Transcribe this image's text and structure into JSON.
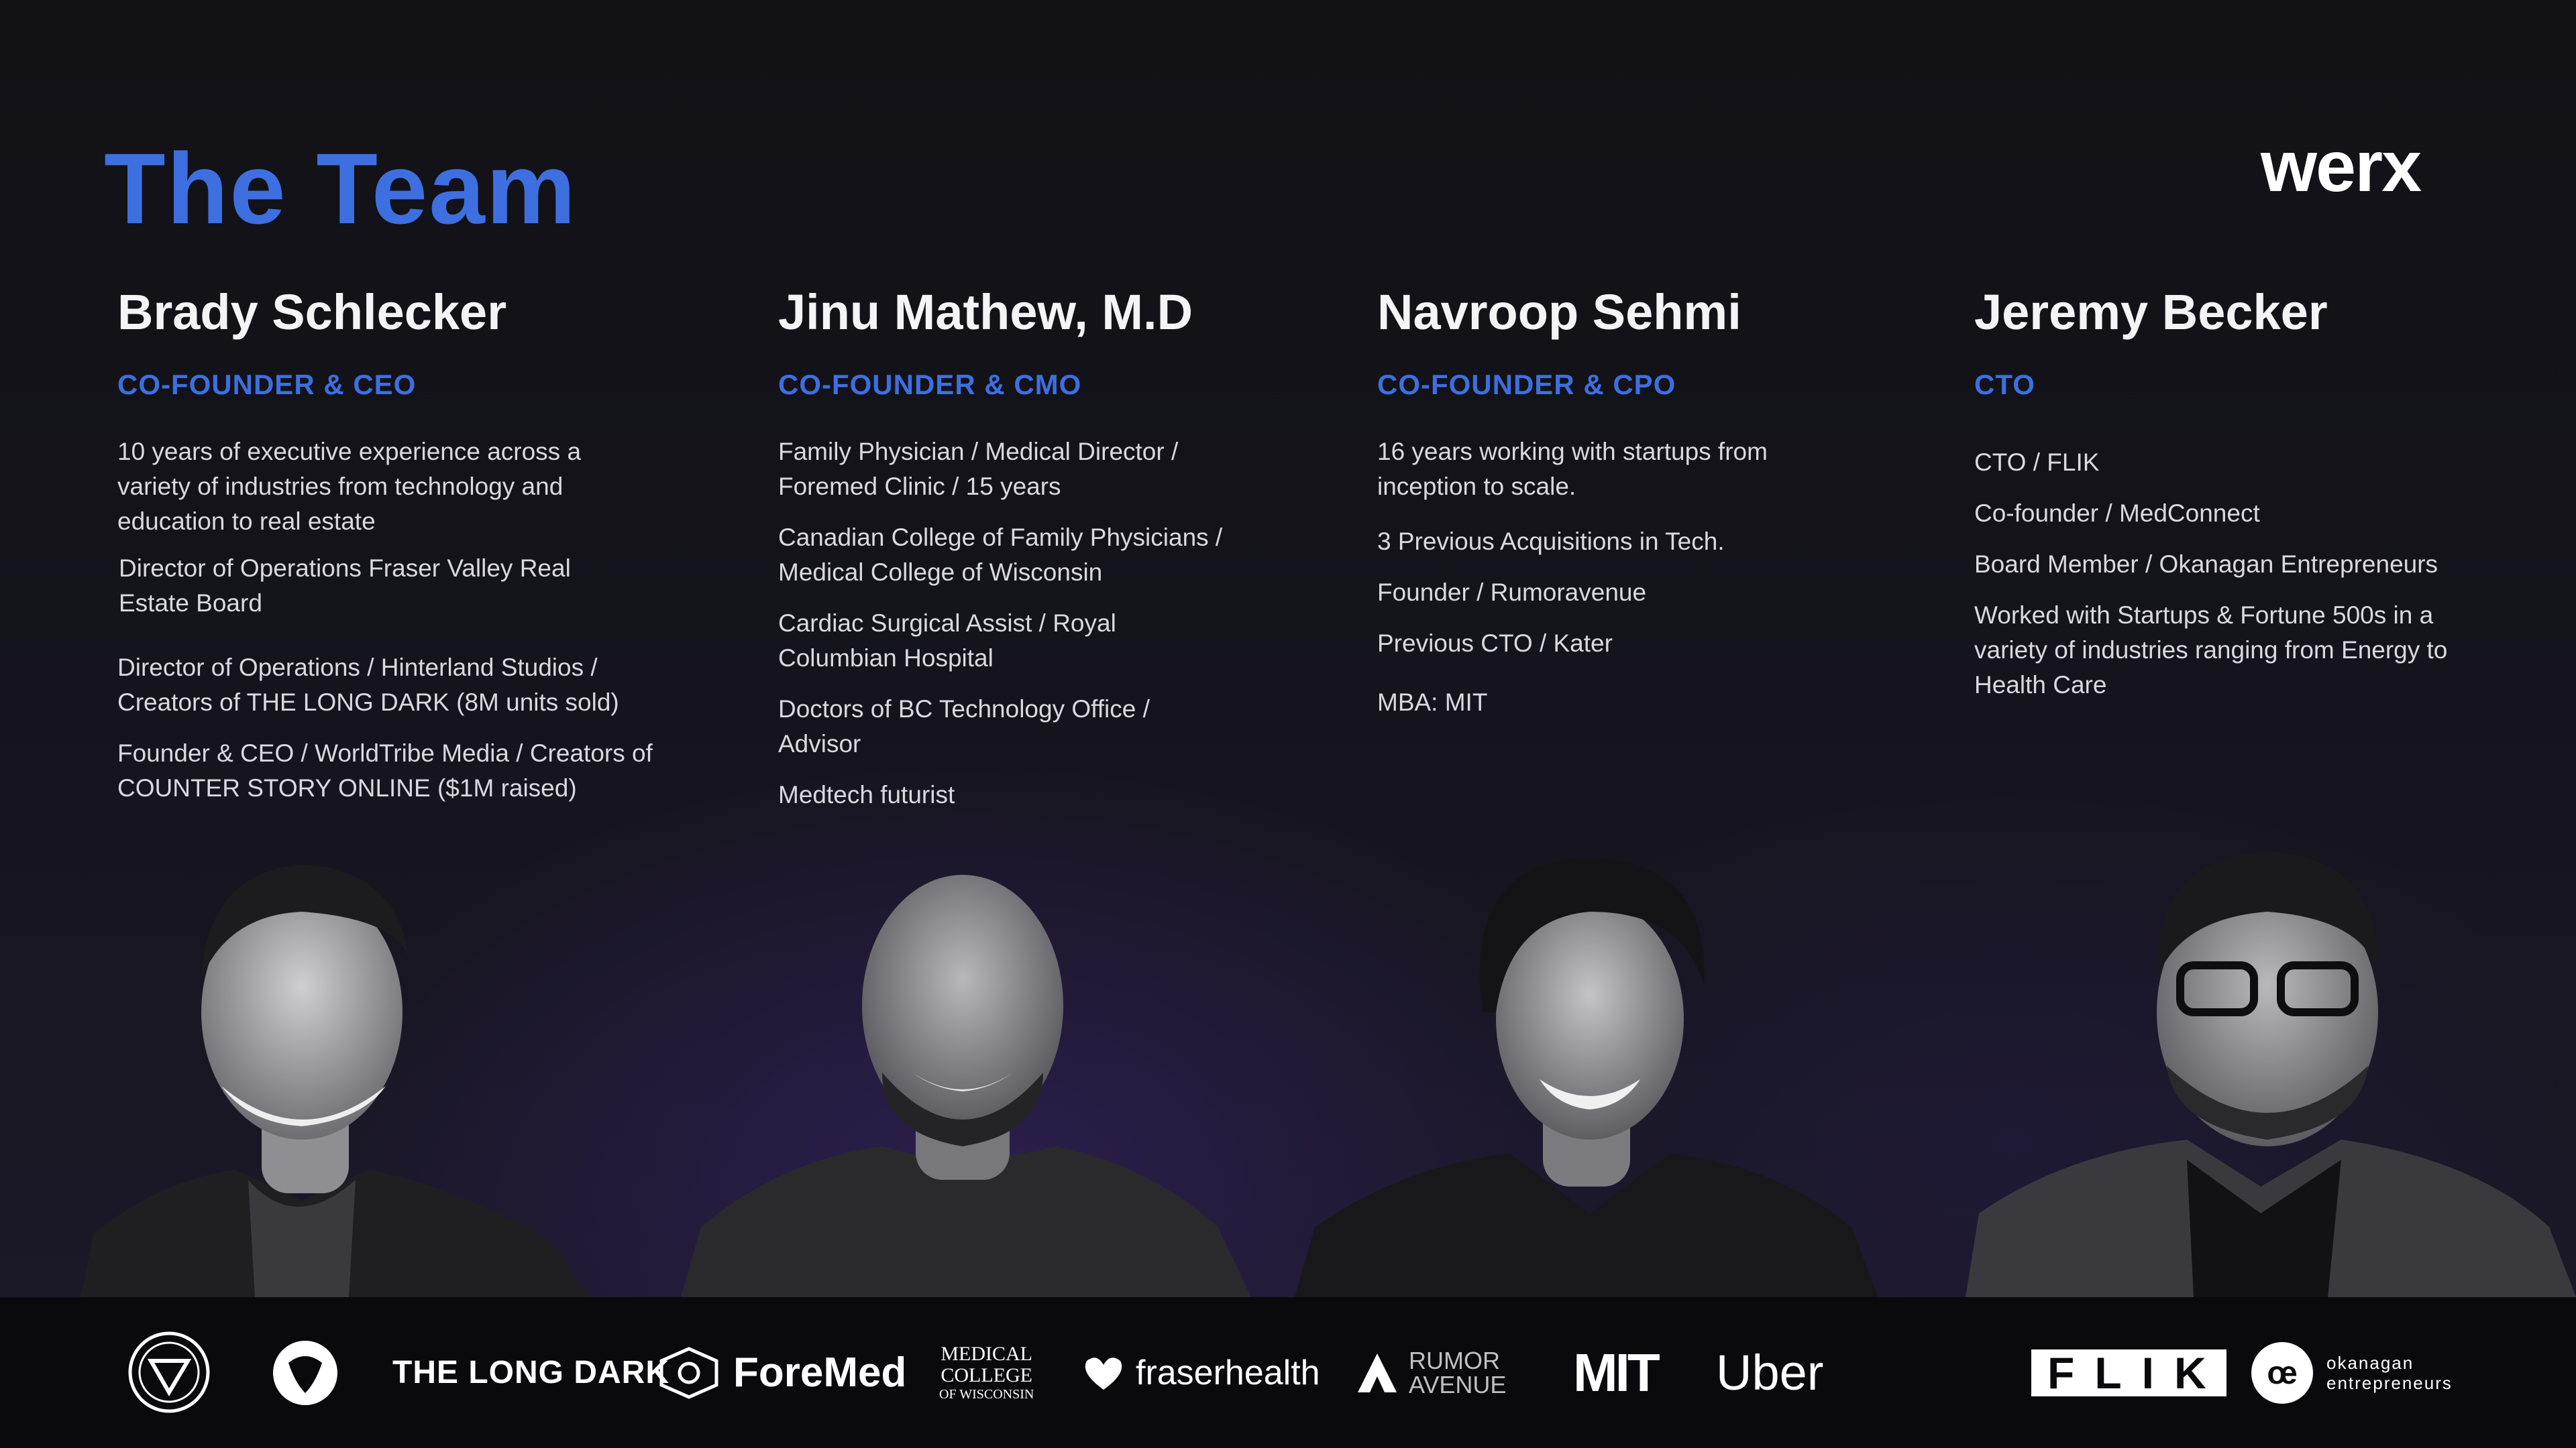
{
  "slide": {
    "title": "The Team",
    "brand_logo": "werx"
  },
  "team": [
    {
      "name": "Brady Schlecker",
      "role": "CO-FOUNDER & CEO",
      "items": [
        "10 years of executive experience across a variety of industries from technology and education to real estate",
        "Director of Operations Fraser Valley Real Estate Board",
        "Director of Operations / Hinterland Studios / Creators of THE LONG DARK (8M units sold)",
        "Founder & CEO / WorldTribe Media / Creators of COUNTER STORY ONLINE ($1M raised)"
      ]
    },
    {
      "name": "Jinu Mathew, M.D",
      "role": "CO-FOUNDER & CMO",
      "items": [
        "Family Physician / Medical Director / Foremed Clinic / 15 years",
        "Canadian College of Family Physicians / Medical College of Wisconsin",
        "Cardiac Surgical Assist / Royal Columbian Hospital",
        "Doctors of BC Technology Office / Advisor",
        "Medtech futurist"
      ]
    },
    {
      "name": "Navroop Sehmi",
      "role": "CO-FOUNDER & CPO",
      "items": [
        "16 years working with startups from inception to scale.",
        "3 Previous Acquisitions in Tech.",
        "Founder / Rumoravenue",
        "Previous CTO / Kater",
        "MBA: MIT"
      ]
    },
    {
      "name": "Jeremy Becker",
      "role": "CTO",
      "items": [
        "CTO / FLIK",
        "Co-founder / MedConnect",
        "Board Member / Okanagan Entrepreneurs",
        "Worked with Startups & Fortune 500s in a variety of industries ranging from Energy to Health Care"
      ]
    }
  ],
  "logos": {
    "long_dark": "THE LONG DARK",
    "foremed": "ForeMed",
    "mcw_line1": "MEDICAL",
    "mcw_line2": "COLLEGE",
    "mcw_line3": "OF WISCONSIN",
    "fraserhealth": "fraserhealth",
    "rumor_line1": "RUMOR",
    "rumor_line2": "AVENUE",
    "mit": "MIT",
    "uber": "Uber",
    "flik": "FLIK",
    "okanagan_line1": "okanagan",
    "okanagan_line2": "entrepreneurs"
  },
  "colors": {
    "accent": "#3d6fe0",
    "background": "#111116",
    "logo_bar": "#0a0a0d"
  }
}
